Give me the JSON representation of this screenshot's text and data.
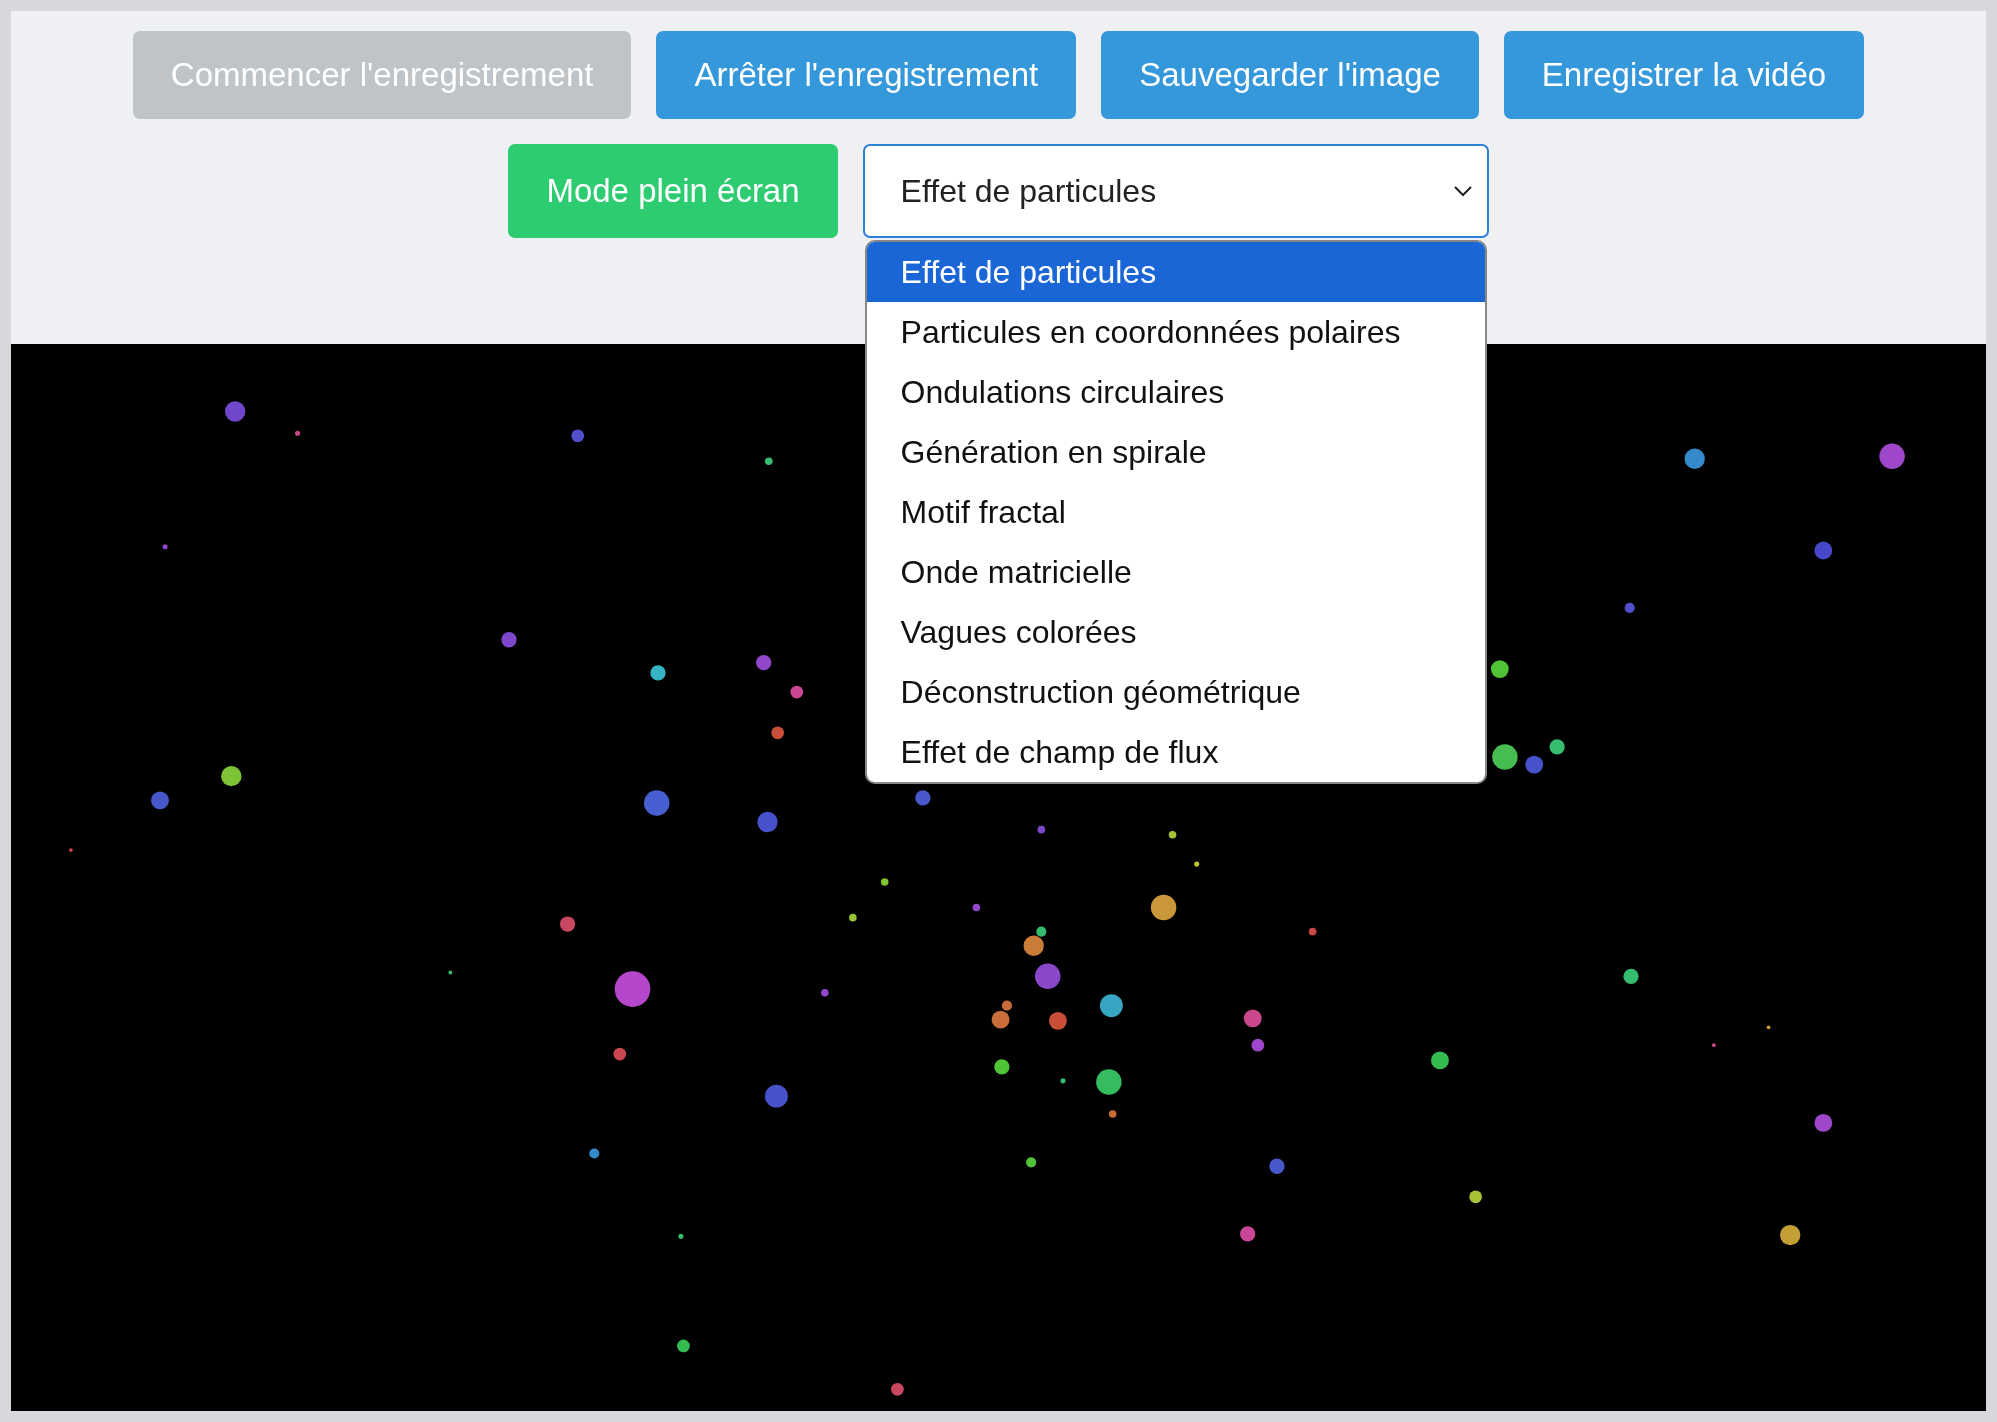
{
  "toolbar": {
    "buttons": [
      {
        "label": "Commencer l'enregistrement",
        "kind": "primary",
        "disabled": true
      },
      {
        "label": "Arrêter l'enregistrement",
        "kind": "primary",
        "disabled": false
      },
      {
        "label": "Sauvegarder l'image",
        "kind": "primary",
        "disabled": false
      },
      {
        "label": "Enregistrer la vidéo",
        "kind": "primary",
        "disabled": false
      }
    ],
    "fullscreen_button": {
      "label": "Mode plein écran",
      "kind": "success"
    },
    "effect_select": {
      "value": "Effet de particules",
      "expanded": true,
      "options": [
        {
          "label": "Effet de particules",
          "selected": true
        },
        {
          "label": "Particules en coordonnées polaires",
          "selected": false
        },
        {
          "label": "Ondulations circulaires",
          "selected": false
        },
        {
          "label": "Génération en spirale",
          "selected": false
        },
        {
          "label": "Motif fractal",
          "selected": false
        },
        {
          "label": "Onde matricielle",
          "selected": false
        },
        {
          "label": "Vagues colorées",
          "selected": false
        },
        {
          "label": "Déconstruction géométrique",
          "selected": false
        },
        {
          "label": "Effet de champ de flux",
          "selected": false
        }
      ]
    }
  }
}
